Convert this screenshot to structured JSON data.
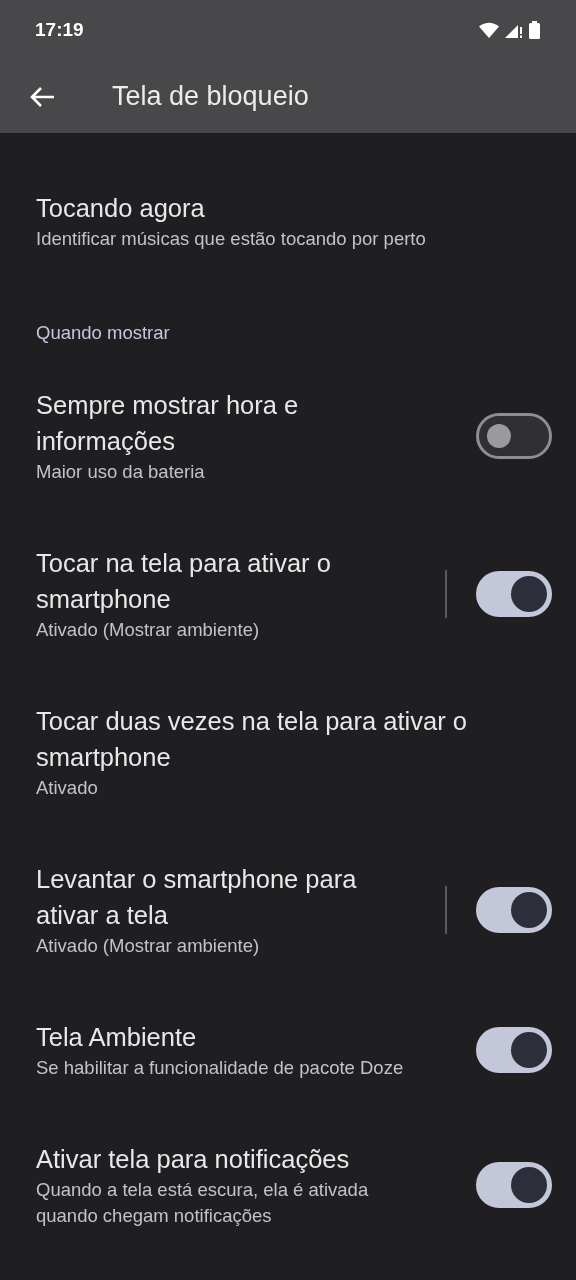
{
  "status_bar": {
    "time": "17:19"
  },
  "app_bar": {
    "title": "Tela de bloqueio"
  },
  "sections": [
    {
      "items": [
        {
          "kind": "item",
          "title": "Tocando agora",
          "subtitle": "Identificar músicas que estão tocando por perto"
        }
      ]
    },
    {
      "header": "Quando mostrar",
      "items": [
        {
          "kind": "switch",
          "title": "Sempre mostrar hora e informações",
          "subtitle": "Maior uso da bateria",
          "on": false,
          "divider": false
        },
        {
          "kind": "switch",
          "title": "Tocar na tela para ativar o smartphone",
          "subtitle": "Ativado (Mostrar ambiente)",
          "on": true,
          "divider": true
        },
        {
          "kind": "item",
          "title": "Tocar duas vezes na tela para ativar o smartphone",
          "subtitle": "Ativado"
        },
        {
          "kind": "switch",
          "title": "Levantar o smartphone para ativar a tela",
          "subtitle": "Ativado (Mostrar ambiente)",
          "on": true,
          "divider": true
        },
        {
          "kind": "switch",
          "title": "Tela Ambiente",
          "subtitle": "Se habilitar a funcionalidade de pacote Doze",
          "on": true,
          "divider": false
        },
        {
          "kind": "switch",
          "title": "Ativar tela para notificações",
          "subtitle": "Quando a tela está escura, ela é ativada quando chegam notificações",
          "on": true,
          "divider": false
        }
      ]
    }
  ]
}
